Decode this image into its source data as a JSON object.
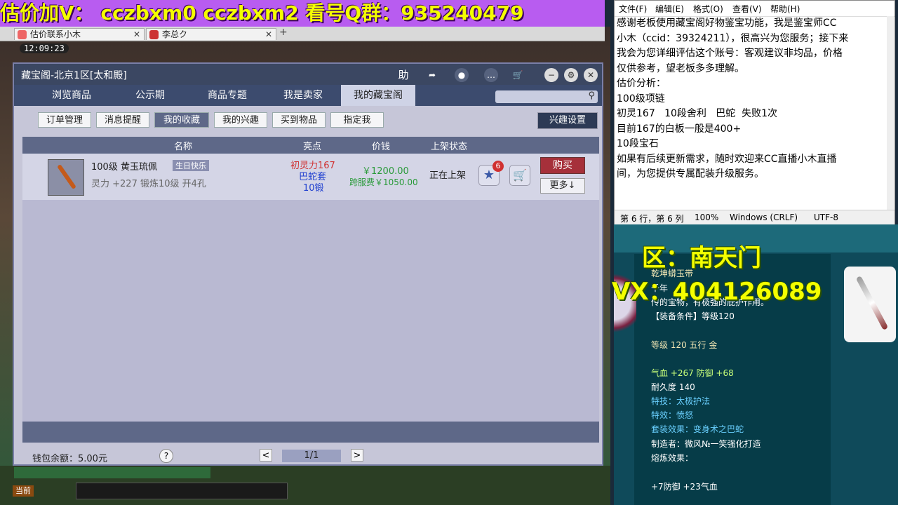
{
  "banner": {
    "text": "估价加V：  cczbxm0   cczbxm2   看号Q群：935240479"
  },
  "browser_tabs": [
    {
      "label": "估价联系小木"
    },
    {
      "label": "李总ク"
    }
  ],
  "game": {
    "clock": "12:09:23",
    "channel_label": "当前"
  },
  "dialog": {
    "title": "藏宝阁-北京1区[太和殿]",
    "help_icon": "助",
    "nav_tabs": [
      "浏览商品",
      "公示期",
      "商品专题",
      "我是卖家",
      "我的藏宝阁"
    ],
    "sub_buttons": [
      "订单管理",
      "消息提醒",
      "我的收藏",
      "我的兴趣",
      "买到物品",
      "指定我"
    ],
    "interest_settings": "兴趣设置",
    "columns": {
      "name": "名称",
      "highlight": "亮点",
      "price": "价钱",
      "status": "上架状态"
    },
    "item": {
      "name": "100级 黄玉琉佩",
      "tag": "生日快乐",
      "attrs": "灵力 +227 锻炼10级 开4孔",
      "highlight1": "初灵力167",
      "highlight2": "巴蛇套",
      "highlight3": "10锻",
      "price": "￥1200.00",
      "service_fee": "跨服费￥1050.00",
      "status": "正在上架",
      "fav_count": "6",
      "buy": "购买",
      "more": "更多↓"
    },
    "wallet": "钱包余额：5.00元",
    "pager": {
      "text": "1/1",
      "prev": "<",
      "next": ">",
      "help": "?"
    }
  },
  "notepad": {
    "menu": [
      "文件(F)",
      "编辑(E)",
      "格式(O)",
      "查看(V)",
      "帮助(H)"
    ],
    "text": "感谢老板使用藏宝阁好物鉴宝功能，我是鉴宝师CC\n小木（ccid：39324211），很高兴为您服务；接下来\n我会为您详细评估这个账号：客观建议非均品，价格\n仅供参考，望老板多多理解。\n估价分析：\n100级项链\n初灵167   10段舍利   巴蛇  失败1次\n目前167的白板一般是400+\n10段宝石\n如果有后续更新需求，随时欢迎来CC直播小木直播\n间，为您提供专属配装升级服务。",
    "status": {
      "pos": "第 6 行，第 6 列",
      "zoom": "100%",
      "eol": "Windows (CRLF)",
      "enc": "UTF-8"
    }
  },
  "overlay": {
    "zone": "区：南天门",
    "wx": "VX：404126089"
  },
  "item_tip": {
    "name": "乾坤蟒玉带",
    "desc1": "千年",
    "desc2": "传的宝物，有极强的庇护作用。",
    "req": "【装备条件】等级120",
    "level": "等级 120 五行 金",
    "stat1": "气血 +267 防御 +68",
    "durability": "耐久度 140",
    "skill": "特技：太极护法",
    "effect": "特效：愤怒",
    "set": "套装效果：变身术之巴蛇",
    "maker": "制造者：微风№一笑强化打造",
    "refine": "熔炼效果：",
    "refine_val": "+7防御 +23气血"
  }
}
